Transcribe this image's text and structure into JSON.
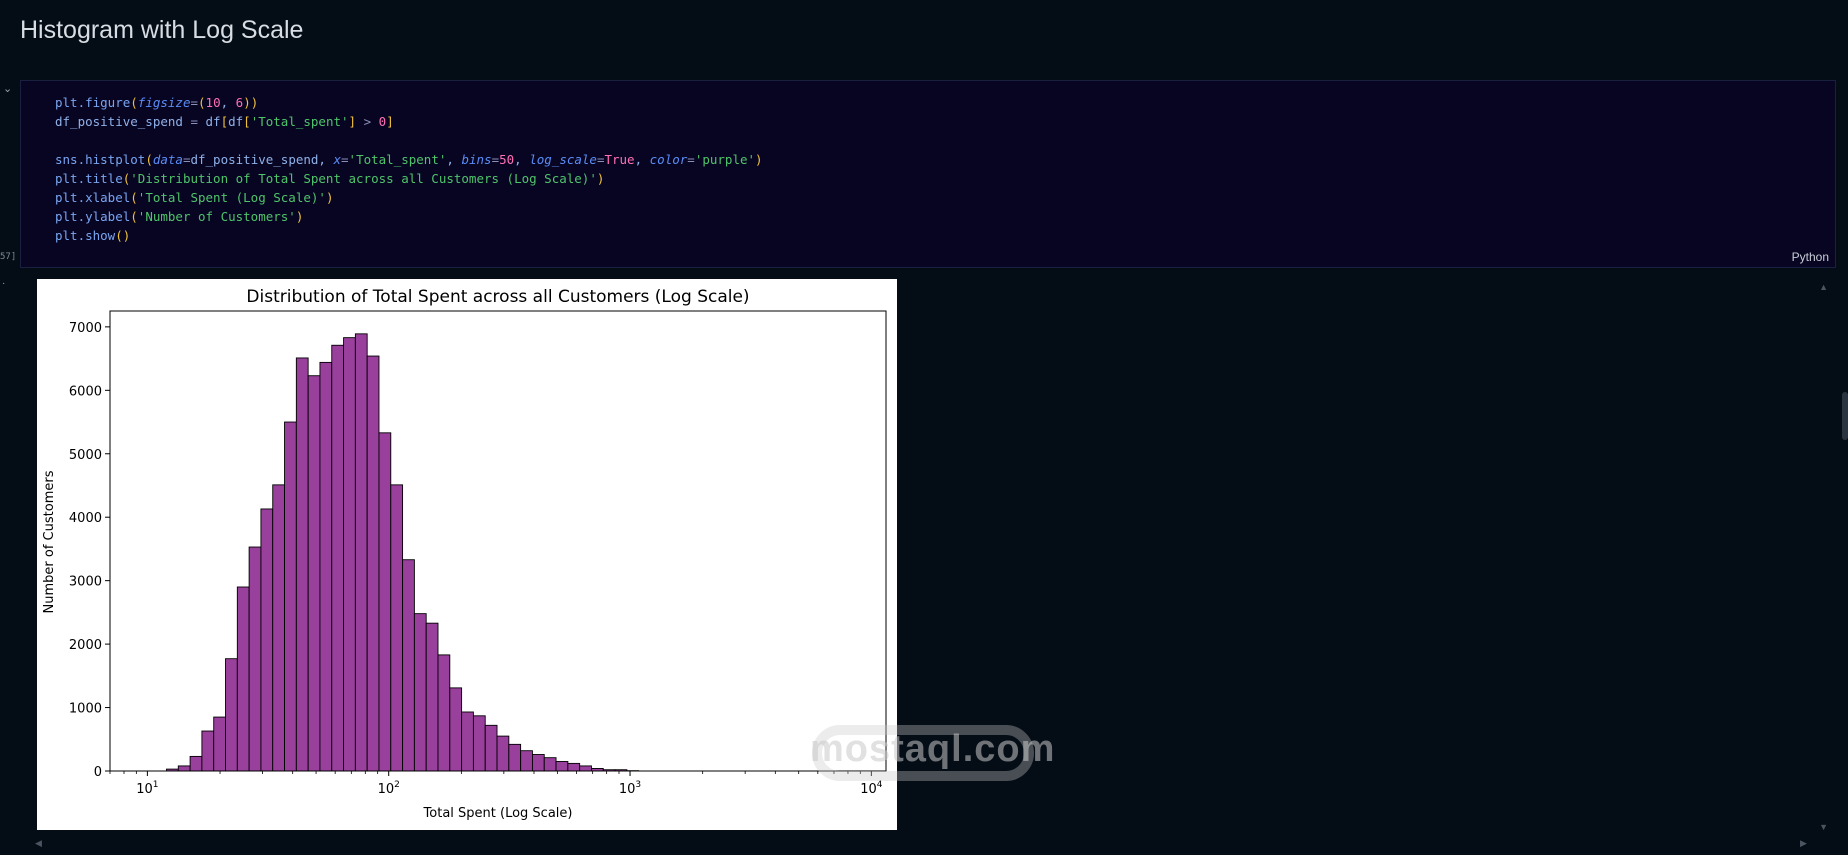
{
  "notebook": {
    "heading": "Histogram with Log Scale",
    "execution_count": "57]",
    "language": "Python"
  },
  "code_lines": [
    [
      [
        "fn",
        "plt.figure"
      ],
      [
        "paren",
        "("
      ],
      [
        "kw",
        "figsize"
      ],
      [
        "op",
        "="
      ],
      [
        "paren",
        "("
      ],
      [
        "num",
        "10"
      ],
      [
        "var",
        ", "
      ],
      [
        "num",
        "6"
      ],
      [
        "paren",
        "))"
      ]
    ],
    [
      [
        "var",
        "df_positive_spend "
      ],
      [
        "op",
        "="
      ],
      [
        "var",
        " df"
      ],
      [
        "paren",
        "["
      ],
      [
        "var",
        "df"
      ],
      [
        "paren",
        "["
      ],
      [
        "str",
        "'Total_spent'"
      ],
      [
        "paren",
        "]"
      ],
      [
        "op",
        " > "
      ],
      [
        "num",
        "0"
      ],
      [
        "paren",
        "]"
      ]
    ],
    [],
    [
      [
        "fn",
        "sns.histplot"
      ],
      [
        "paren",
        "("
      ],
      [
        "kw",
        "data"
      ],
      [
        "op",
        "="
      ],
      [
        "var",
        "df_positive_spend, "
      ],
      [
        "kw",
        "x"
      ],
      [
        "op",
        "="
      ],
      [
        "str",
        "'Total_spent'"
      ],
      [
        "var",
        ", "
      ],
      [
        "kw",
        "bins"
      ],
      [
        "op",
        "="
      ],
      [
        "num",
        "50"
      ],
      [
        "var",
        ", "
      ],
      [
        "kw",
        "log_scale"
      ],
      [
        "op",
        "="
      ],
      [
        "bool",
        "True"
      ],
      [
        "var",
        ", "
      ],
      [
        "kw",
        "color"
      ],
      [
        "op",
        "="
      ],
      [
        "str",
        "'purple'"
      ],
      [
        "paren",
        ")"
      ]
    ],
    [
      [
        "fn",
        "plt.title"
      ],
      [
        "paren",
        "("
      ],
      [
        "str",
        "'Distribution of Total Spent across all Customers (Log Scale)'"
      ],
      [
        "paren",
        ")"
      ]
    ],
    [
      [
        "fn",
        "plt.xlabel"
      ],
      [
        "paren",
        "("
      ],
      [
        "str",
        "'Total Spent (Log Scale)'"
      ],
      [
        "paren",
        ")"
      ]
    ],
    [
      [
        "fn",
        "plt.ylabel"
      ],
      [
        "paren",
        "("
      ],
      [
        "str",
        "'Number of Customers'"
      ],
      [
        "paren",
        ")"
      ]
    ],
    [
      [
        "fn",
        "plt.show"
      ],
      [
        "paren",
        "()"
      ]
    ]
  ],
  "colors": {
    "bar_fill": "#993f9c",
    "bar_edge": "#000000",
    "background": "#040d16",
    "code_bg": "#080523"
  },
  "chart_data": {
    "type": "bar",
    "title": "Distribution of Total Spent across all Customers (Log Scale)",
    "xlabel": "Total Spent (Log Scale)",
    "ylabel": "Number of Customers",
    "x_scale": "log",
    "xlim": [
      7,
      11500
    ],
    "ylim": [
      0,
      7250
    ],
    "x_ticks": [
      {
        "value": 10,
        "base": "10",
        "exp": "1"
      },
      {
        "value": 100,
        "base": "10",
        "exp": "2"
      },
      {
        "value": 1000,
        "base": "10",
        "exp": "3"
      },
      {
        "value": 10000,
        "base": "10",
        "exp": "4"
      }
    ],
    "y_ticks": [
      0,
      1000,
      2000,
      3000,
      4000,
      5000,
      6000,
      7000
    ],
    "bin_start": 12,
    "bin_end": 3350,
    "values": [
      30,
      80,
      230,
      630,
      850,
      1770,
      2900,
      3530,
      4130,
      4510,
      5500,
      6510,
      6230,
      6440,
      6710,
      6830,
      6890,
      6540,
      5330,
      4510,
      3330,
      2480,
      2330,
      1830,
      1310,
      930,
      870,
      720,
      550,
      420,
      320,
      260,
      210,
      150,
      120,
      80,
      40,
      20,
      20,
      5,
      0,
      0,
      0,
      0,
      0,
      0,
      0,
      0,
      0,
      0
    ],
    "grid": false,
    "legend": "none"
  },
  "watermark": {
    "text": "mostaql.com"
  }
}
